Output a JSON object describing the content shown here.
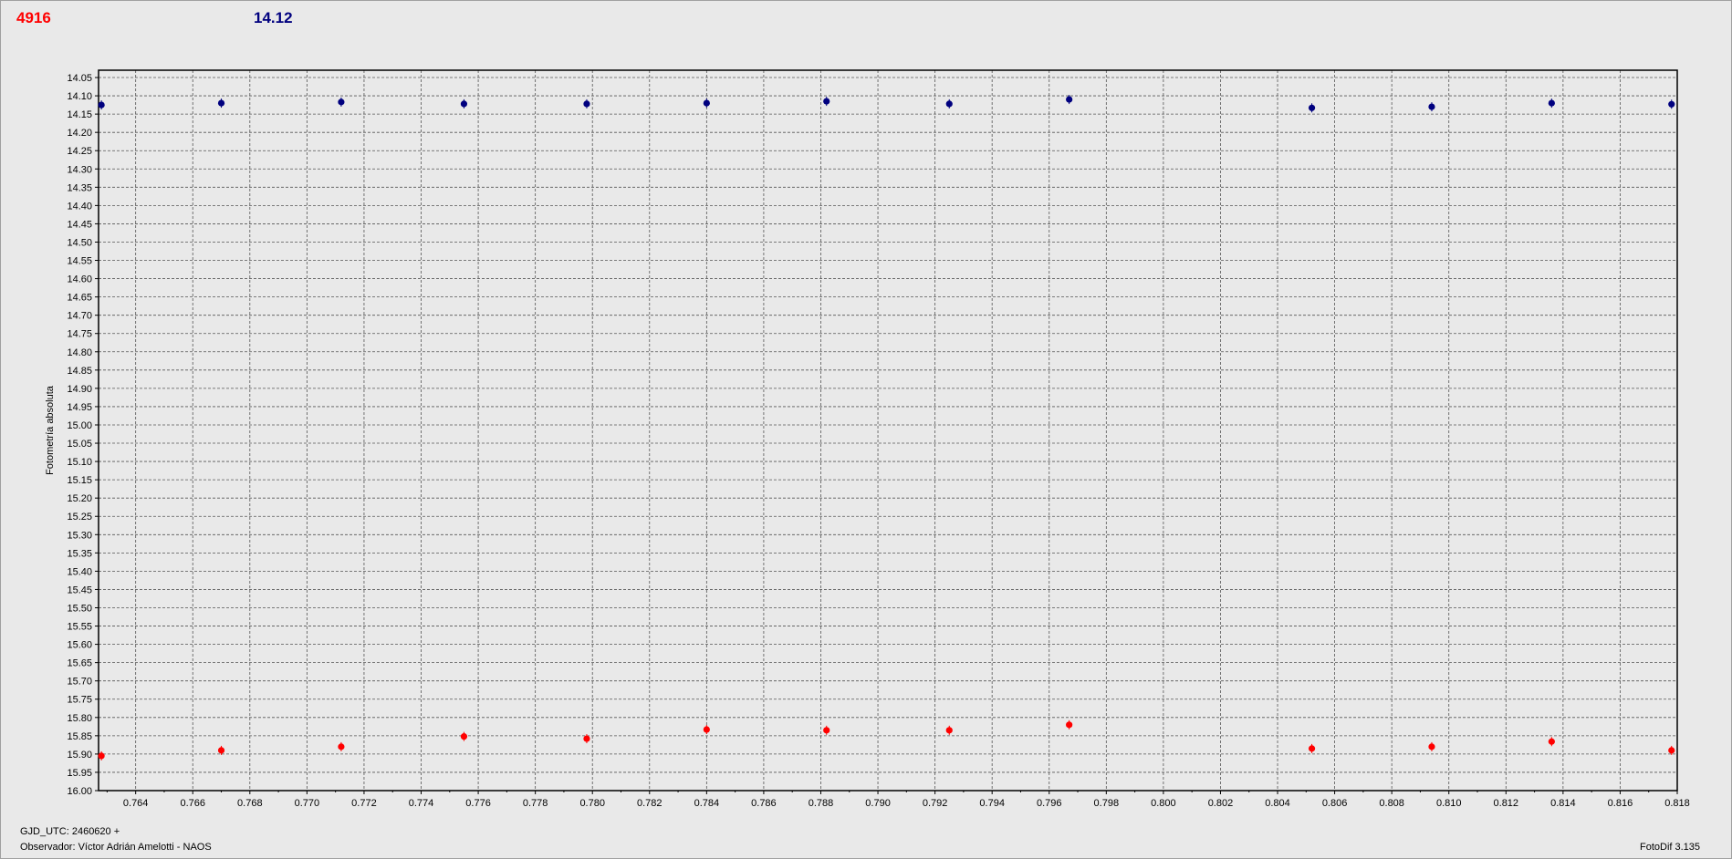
{
  "header": {
    "red_value": "4916",
    "blue_value": "14.12"
  },
  "footer": {
    "gjd_label": "GJD_UTC: 2460620 +",
    "observer": "Observador: Víctor Adrián Amelotti - NAOS",
    "software": "FotoDif 3.135"
  },
  "colors": {
    "red_series": "#ff0000",
    "blue_series": "#00007f",
    "grid": "#555555"
  },
  "chart_data": {
    "type": "scatter",
    "title": "",
    "xlabel": "",
    "ylabel": "Fotometría absoluta",
    "xlim": [
      0.7627,
      0.818
    ],
    "ylim": [
      16.0,
      14.03
    ],
    "y_inverted": true,
    "grid": true,
    "x_ticks": [
      "0.764",
      "0.766",
      "0.768",
      "0.770",
      "0.772",
      "0.774",
      "0.776",
      "0.778",
      "0.780",
      "0.782",
      "0.784",
      "0.786",
      "0.788",
      "0.790",
      "0.792",
      "0.794",
      "0.796",
      "0.798",
      "0.800",
      "0.802",
      "0.804",
      "0.806",
      "0.808",
      "0.810",
      "0.812",
      "0.814",
      "0.816",
      "0.818"
    ],
    "y_ticks": [
      "14.05",
      "14.10",
      "14.15",
      "14.20",
      "14.25",
      "14.30",
      "14.35",
      "14.40",
      "14.45",
      "14.50",
      "14.55",
      "14.60",
      "14.65",
      "14.70",
      "14.75",
      "14.80",
      "14.85",
      "14.90",
      "14.95",
      "15.00",
      "15.05",
      "15.10",
      "15.15",
      "15.20",
      "15.25",
      "15.30",
      "15.35",
      "15.40",
      "15.45",
      "15.50",
      "15.55",
      "15.60",
      "15.65",
      "15.70",
      "15.75",
      "15.80",
      "15.85",
      "15.90",
      "15.95",
      "16.00"
    ],
    "x": [
      0.7628,
      0.767,
      0.7712,
      0.7755,
      0.7798,
      0.784,
      0.7882,
      0.7925,
      0.7967,
      0.8052,
      0.8094,
      0.8136,
      0.8178
    ],
    "series": [
      {
        "color": "#00007f",
        "values": [
          14.125,
          14.12,
          14.117,
          14.122,
          14.122,
          14.12,
          14.115,
          14.122,
          14.11,
          14.133,
          14.13,
          14.12,
          14.123
        ]
      },
      {
        "color": "#ff0000",
        "values": [
          15.905,
          15.89,
          15.88,
          15.852,
          15.858,
          15.833,
          15.835,
          15.835,
          15.82,
          15.885,
          15.88,
          15.866,
          15.89
        ]
      }
    ]
  }
}
